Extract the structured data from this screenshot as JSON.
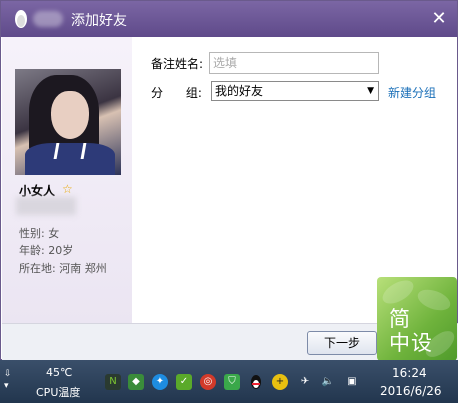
{
  "window": {
    "title": "添加好友",
    "close_glyph": "✕"
  },
  "profile": {
    "nickname": "小女人",
    "gender": "性别: 女",
    "age": "年龄: 20岁",
    "location": "所在地: 河南  郑州"
  },
  "form": {
    "remark_label": "备注姓名:",
    "remark_placeholder": "选填",
    "remark_value": "",
    "group_label": "分      组:",
    "group_selected": "我的好友",
    "new_group_link": "新建分组"
  },
  "footer": {
    "next_button": "下一步"
  },
  "watermark": {
    "text_line1": "简",
    "text_line2": "中设"
  },
  "taskbar": {
    "temperature": "45℃",
    "cpu_label": "CPU温度",
    "time": "16:24",
    "date": "2016/6/26",
    "tray_icons": [
      "nvidia-icon",
      "safari-icon",
      "check-icon",
      "netease-music-icon",
      "shield-icon",
      "qq-icon",
      "plus-icon",
      "network-icon",
      "volume-icon",
      "computer-icon"
    ]
  },
  "colors": {
    "titlebar": "#6a5596",
    "link": "#1a6fb8",
    "star": "#e8a800"
  }
}
